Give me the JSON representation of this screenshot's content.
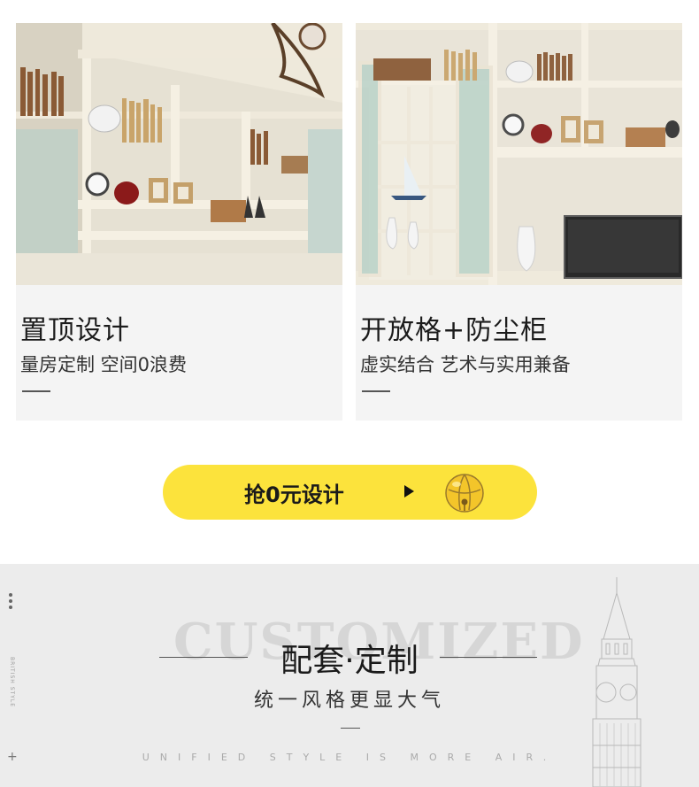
{
  "cards": [
    {
      "title": "置顶设计",
      "subtitle": "量房定制 空间0浪费"
    },
    {
      "title": "开放格+防尘柜",
      "subtitle": "虚实结合 艺术与实用兼备"
    }
  ],
  "cta": {
    "label": "抢0元设计",
    "arrow_icon": "play-arrow-icon",
    "bell_icon": "bell-icon"
  },
  "section": {
    "bg_word": "CUSTOMIZED",
    "title": "配套·定制",
    "subtitle": "统一风格更显大气",
    "english": "UNIFIED STYLE IS MORE AIR.",
    "side_text": "BRITISH STYLE",
    "plus": "+"
  },
  "colors": {
    "cta_yellow": "#fce33c",
    "card_bg": "#f4f4f4",
    "section_bg": "#ececec"
  }
}
